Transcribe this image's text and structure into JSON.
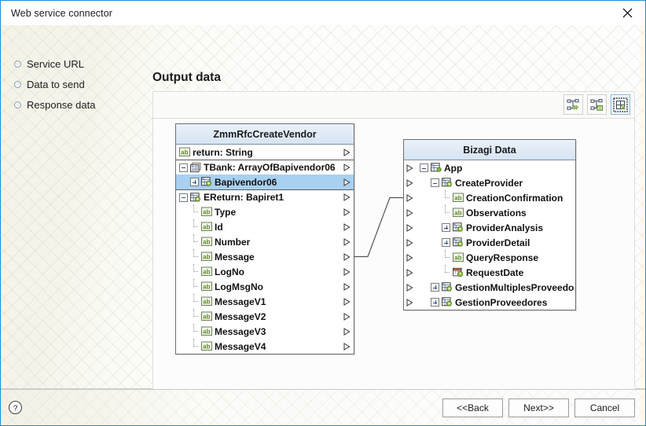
{
  "window": {
    "title": "Web service connector",
    "close_icon": "close-icon"
  },
  "sidebar": {
    "items": [
      {
        "label": "Service URL",
        "icon": "radio-bullet-icon"
      },
      {
        "label": "Data to send",
        "icon": "radio-bullet-icon"
      },
      {
        "label": "Response data",
        "icon": "radio-bullet-icon"
      }
    ]
  },
  "main": {
    "title": "Output data",
    "toolbar": {
      "buttons": [
        {
          "name": "auto-map-button",
          "icon": "tree-arrows-icon",
          "selected": false
        },
        {
          "name": "map-options-button",
          "icon": "tree-list-icon",
          "selected": false
        },
        {
          "name": "fit-to-window-button",
          "icon": "resize-diagonal-icon",
          "selected": true
        }
      ]
    }
  },
  "left_tree": {
    "header": "ZmmRfcCreateVendor",
    "rows": [
      {
        "label": "return: String",
        "icon": "string-ab-icon",
        "indent": 0,
        "expander": "none",
        "connector": "none",
        "selected": false,
        "thick_top": false,
        "arrow": "right-triangle-icon"
      },
      {
        "label": "TBank: ArrayOfBapivendor06",
        "icon": "array-icon",
        "indent": 0,
        "expander": "minus",
        "connector": "none",
        "selected": false,
        "thick_top": true,
        "arrow": "right-triangle-icon"
      },
      {
        "label": "Bapivendor06",
        "icon": "entity-icon",
        "indent": 1,
        "expander": "plus",
        "connector": "none",
        "selected": true,
        "thick_top": false,
        "arrow": "right-triangle-icon"
      },
      {
        "label": "EReturn: Bapiret1",
        "icon": "entity-icon",
        "indent": 0,
        "expander": "minus",
        "connector": "none",
        "selected": false,
        "thick_top": true,
        "arrow": "right-triangle-icon"
      },
      {
        "label": "Type",
        "icon": "string-ab-icon",
        "indent": 1,
        "expander": "none",
        "connector": "tee",
        "selected": false,
        "thick_top": false,
        "arrow": "right-triangle-icon"
      },
      {
        "label": "Id",
        "icon": "string-ab-icon",
        "indent": 1,
        "expander": "none",
        "connector": "tee",
        "selected": false,
        "thick_top": false,
        "arrow": "right-triangle-icon"
      },
      {
        "label": "Number",
        "icon": "string-ab-icon",
        "indent": 1,
        "expander": "none",
        "connector": "tee",
        "selected": false,
        "thick_top": false,
        "arrow": "right-triangle-icon"
      },
      {
        "label": "Message",
        "icon": "string-ab-icon",
        "indent": 1,
        "expander": "none",
        "connector": "tee",
        "selected": false,
        "thick_top": false,
        "arrow": "right-triangle-icon"
      },
      {
        "label": "LogNo",
        "icon": "string-ab-icon",
        "indent": 1,
        "expander": "none",
        "connector": "tee",
        "selected": false,
        "thick_top": false,
        "arrow": "right-triangle-icon"
      },
      {
        "label": "LogMsgNo",
        "icon": "string-ab-icon",
        "indent": 1,
        "expander": "none",
        "connector": "tee",
        "selected": false,
        "thick_top": false,
        "arrow": "right-triangle-icon"
      },
      {
        "label": "MessageV1",
        "icon": "string-ab-icon",
        "indent": 1,
        "expander": "none",
        "connector": "tee",
        "selected": false,
        "thick_top": false,
        "arrow": "right-triangle-icon"
      },
      {
        "label": "MessageV2",
        "icon": "string-ab-icon",
        "indent": 1,
        "expander": "none",
        "connector": "tee",
        "selected": false,
        "thick_top": false,
        "arrow": "right-triangle-icon"
      },
      {
        "label": "MessageV3",
        "icon": "string-ab-icon",
        "indent": 1,
        "expander": "none",
        "connector": "tee",
        "selected": false,
        "thick_top": false,
        "arrow": "right-triangle-icon"
      },
      {
        "label": "MessageV4",
        "icon": "string-ab-icon",
        "indent": 1,
        "expander": "none",
        "connector": "last",
        "selected": false,
        "thick_top": false,
        "arrow": "right-triangle-icon"
      }
    ]
  },
  "right_tree": {
    "header": "Bizagi Data",
    "rows": [
      {
        "label": "App",
        "icon": "app-entity-icon",
        "indent": 0,
        "expander": "minus",
        "connector": "none",
        "arrow": "right-triangle-icon"
      },
      {
        "label": "CreateProvider",
        "icon": "entity-icon",
        "indent": 1,
        "expander": "minus",
        "connector": "none",
        "arrow": "right-triangle-icon"
      },
      {
        "label": "CreationConfirmation",
        "icon": "string-ab-icon",
        "indent": 2,
        "expander": "none",
        "connector": "tee",
        "arrow": "right-triangle-icon"
      },
      {
        "label": "Observations",
        "icon": "string-ab-icon",
        "indent": 2,
        "expander": "none",
        "connector": "tee",
        "arrow": "right-triangle-icon"
      },
      {
        "label": "ProviderAnalysis",
        "icon": "entity-icon",
        "indent": 2,
        "expander": "plus",
        "connector": "none",
        "arrow": "right-triangle-icon"
      },
      {
        "label": "ProviderDetail",
        "icon": "entity-icon",
        "indent": 2,
        "expander": "plus",
        "connector": "none",
        "arrow": "right-triangle-icon"
      },
      {
        "label": "QueryResponse",
        "icon": "string-ab-icon",
        "indent": 2,
        "expander": "none",
        "connector": "tee",
        "arrow": "right-triangle-icon"
      },
      {
        "label": "RequestDate",
        "icon": "date-icon",
        "indent": 2,
        "expander": "none",
        "connector": "last",
        "arrow": "right-triangle-icon"
      },
      {
        "label": "GestionMultiplesProveedo",
        "icon": "entity-icon",
        "indent": 1,
        "expander": "plus",
        "connector": "none",
        "arrow": "right-triangle-icon"
      },
      {
        "label": "GestionProveedores",
        "icon": "entity-icon",
        "indent": 1,
        "expander": "plus",
        "connector": "none",
        "arrow": "right-triangle-icon"
      }
    ]
  },
  "mapping": {
    "links": [
      {
        "from": "Message",
        "to": "CreationConfirmation"
      }
    ]
  },
  "footer": {
    "help_icon": "help-circle-icon",
    "buttons": [
      {
        "name": "back-button",
        "label": "<<Back"
      },
      {
        "name": "next-button",
        "label": "Next>>"
      },
      {
        "name": "cancel-button",
        "label": "Cancel"
      }
    ]
  },
  "colors": {
    "accent_border": "#1a8cd8",
    "selection": "#a8d0f0",
    "header_gradient_top": "#eaf2fb",
    "header_gradient_bottom": "#d6e4f3",
    "icon_green": "#6ba33a",
    "connector_line": "#555555"
  }
}
